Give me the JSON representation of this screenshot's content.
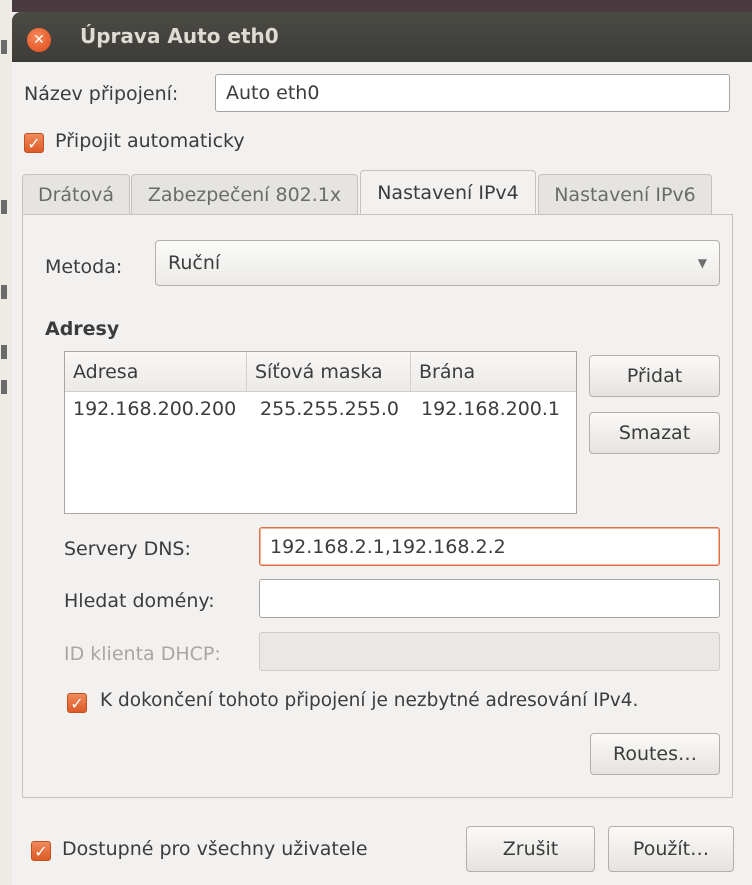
{
  "window": {
    "title": "Úprava Auto eth0"
  },
  "connection_name": {
    "label": "Název připojení:",
    "value": "Auto eth0"
  },
  "auto_connect": {
    "label": "Připojit automaticky",
    "checked": true
  },
  "tabs": [
    {
      "label": "Drátová"
    },
    {
      "label": "Zabezpečení 802.1x"
    },
    {
      "label": "Nastavení IPv4",
      "active": true
    },
    {
      "label": "Nastavení IPv6"
    }
  ],
  "method": {
    "label": "Metoda:",
    "value": "Ruční"
  },
  "addresses": {
    "heading": "Adresy",
    "columns": [
      "Adresa",
      "Síťová maska",
      "Brána"
    ],
    "rows": [
      [
        "192.168.200.200",
        "255.255.255.0",
        "192.168.200.1"
      ]
    ],
    "add_label": "Přidat",
    "delete_label": "Smazat"
  },
  "dns": {
    "label": "Servery DNS:",
    "value": "192.168.2.1,192.168.2.2"
  },
  "search_domains": {
    "label": "Hledat domény:",
    "value": ""
  },
  "dhcp_client_id": {
    "label": "ID klienta DHCP:",
    "value": ""
  },
  "require_ipv4": {
    "label": "K dokončení tohoto připojení je nezbytné adresování IPv4.",
    "checked": true
  },
  "routes_label": "Routes…",
  "all_users": {
    "label": "Dostupné pro všechny uživatele",
    "checked": true
  },
  "buttons": {
    "cancel": "Zrušit",
    "apply": "Použít…"
  },
  "icons": {
    "close": "close-icon",
    "check": "check-icon",
    "dropdown": "chevron-down-icon"
  },
  "colors": {
    "accent": "#e05a24",
    "titlebar": "#3f3e3a"
  }
}
